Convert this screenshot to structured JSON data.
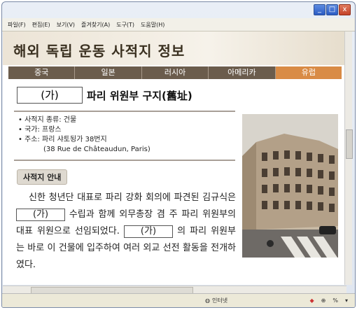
{
  "window": {
    "buttons": [
      "_",
      "□",
      "x"
    ]
  },
  "menu": [
    "파일(F)",
    "편집(E)",
    "보기(V)",
    "즐겨찾기(A)",
    "도구(T)",
    "도움말(H)"
  ],
  "page": {
    "title": "해외 독립 운동 사적지 정보",
    "tabs": [
      "중국",
      "일본",
      "러시아",
      "아메리카",
      "유럽"
    ],
    "active_tab": "유럽",
    "blank_label": "(가)",
    "heading": "파리 위원부 구지(舊址)",
    "info": {
      "type": "사적지 종류: 건물",
      "country": "국가: 프랑스",
      "address": "주소: 파리 샤토됭가 38번지",
      "address_fr": "(38 Rue de Châteaudun, Paris)"
    },
    "guide_label": "사적지 안내",
    "paragraph": {
      "part1": "신한 청년단 대표로 파리 강화 회의에 파견된 김규식은",
      "part2": "수립과 함께 외무총장 겸 주 파리 위원부의 대표 위원으로 선임되었다.",
      "part3": "의 파리 위원부는 바로 이 건물에 입주하여 여러 외교 선전 활동을 전개하였다."
    }
  },
  "status": {
    "zone": "인터넷",
    "zoom_label": "%"
  },
  "colors": {
    "tab_bar": "#6b5c4c",
    "active_tab": "#d98b45"
  }
}
